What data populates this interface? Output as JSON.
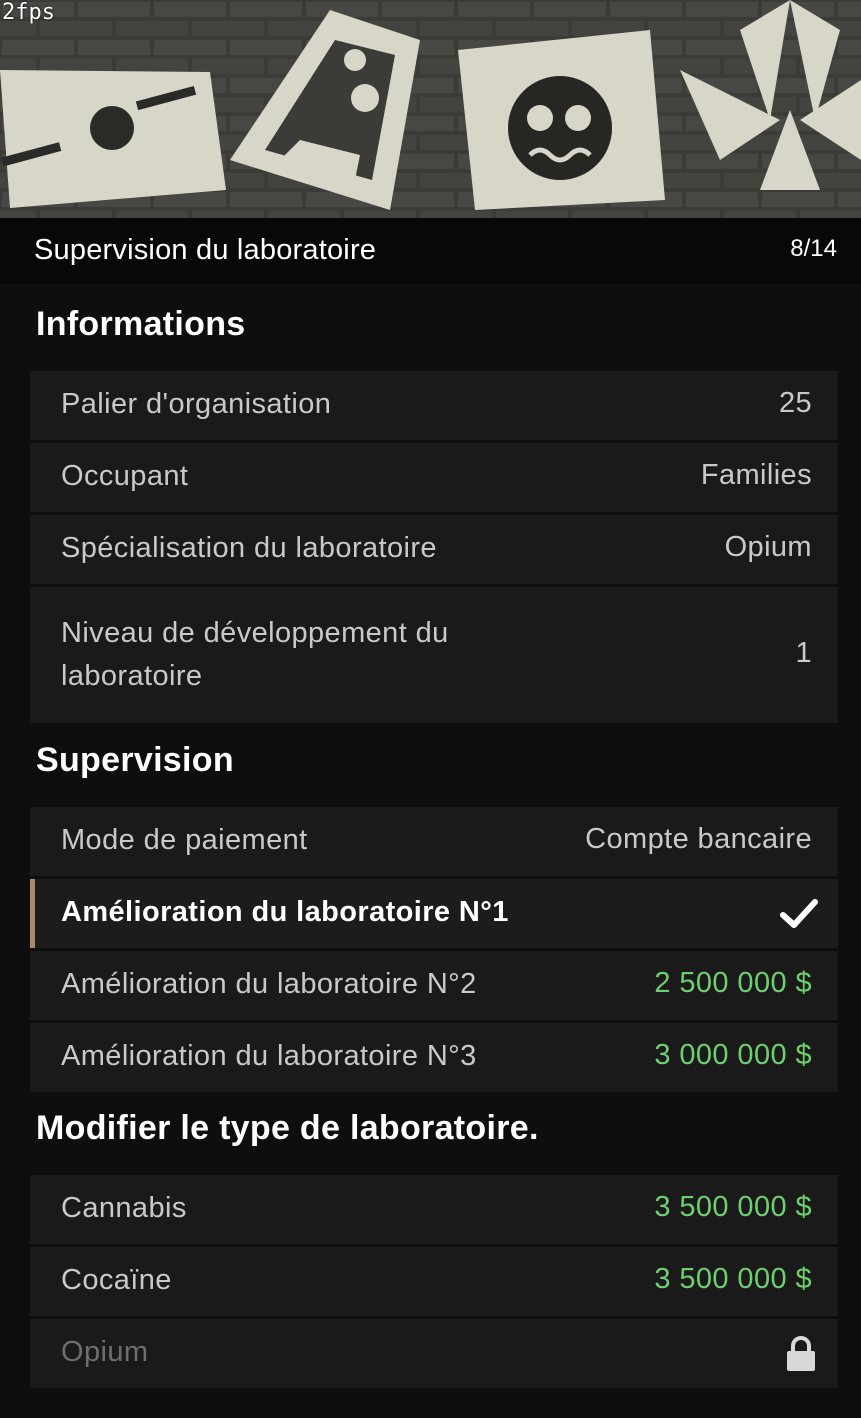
{
  "overlay": {
    "fps": "2fps"
  },
  "menu": {
    "title": "Supervision du laboratoire",
    "counter": "8/14"
  },
  "sections": {
    "informations": {
      "heading": "Informations",
      "rows": [
        {
          "label": "Palier d'organisation",
          "value": "25"
        },
        {
          "label": "Occupant",
          "value": "Families"
        },
        {
          "label": "Spécialisation du laboratoire",
          "value": "Opium"
        },
        {
          "label": "Niveau de développement du laboratoire",
          "value": "1"
        }
      ]
    },
    "supervision": {
      "heading": "Supervision",
      "rows": [
        {
          "label": "Mode de paiement",
          "value": "Compte bancaire"
        },
        {
          "label": "Amélioration du laboratoire N°1",
          "value": "",
          "icon": "checkmark-icon",
          "selected": true
        },
        {
          "label": "Amélioration du laboratoire N°2",
          "value": "2 500 000 $"
        },
        {
          "label": "Amélioration du laboratoire N°3",
          "value": "3 000 000 $"
        }
      ]
    },
    "modifier": {
      "heading": "Modifier le type de laboratoire.",
      "rows": [
        {
          "label": "Cannabis",
          "value": "3 500 000 $"
        },
        {
          "label": "Cocaïne",
          "value": "3 500 000 $"
        },
        {
          "label": "Opium",
          "value": "",
          "icon": "lock-icon",
          "locked": true
        }
      ]
    }
  },
  "colors": {
    "background": "#0e0e0e",
    "row": "#1a1a1a",
    "price": "#6fcf6f",
    "selected_accent": "#a68a6d",
    "locked_text": "#6e6e6e"
  }
}
